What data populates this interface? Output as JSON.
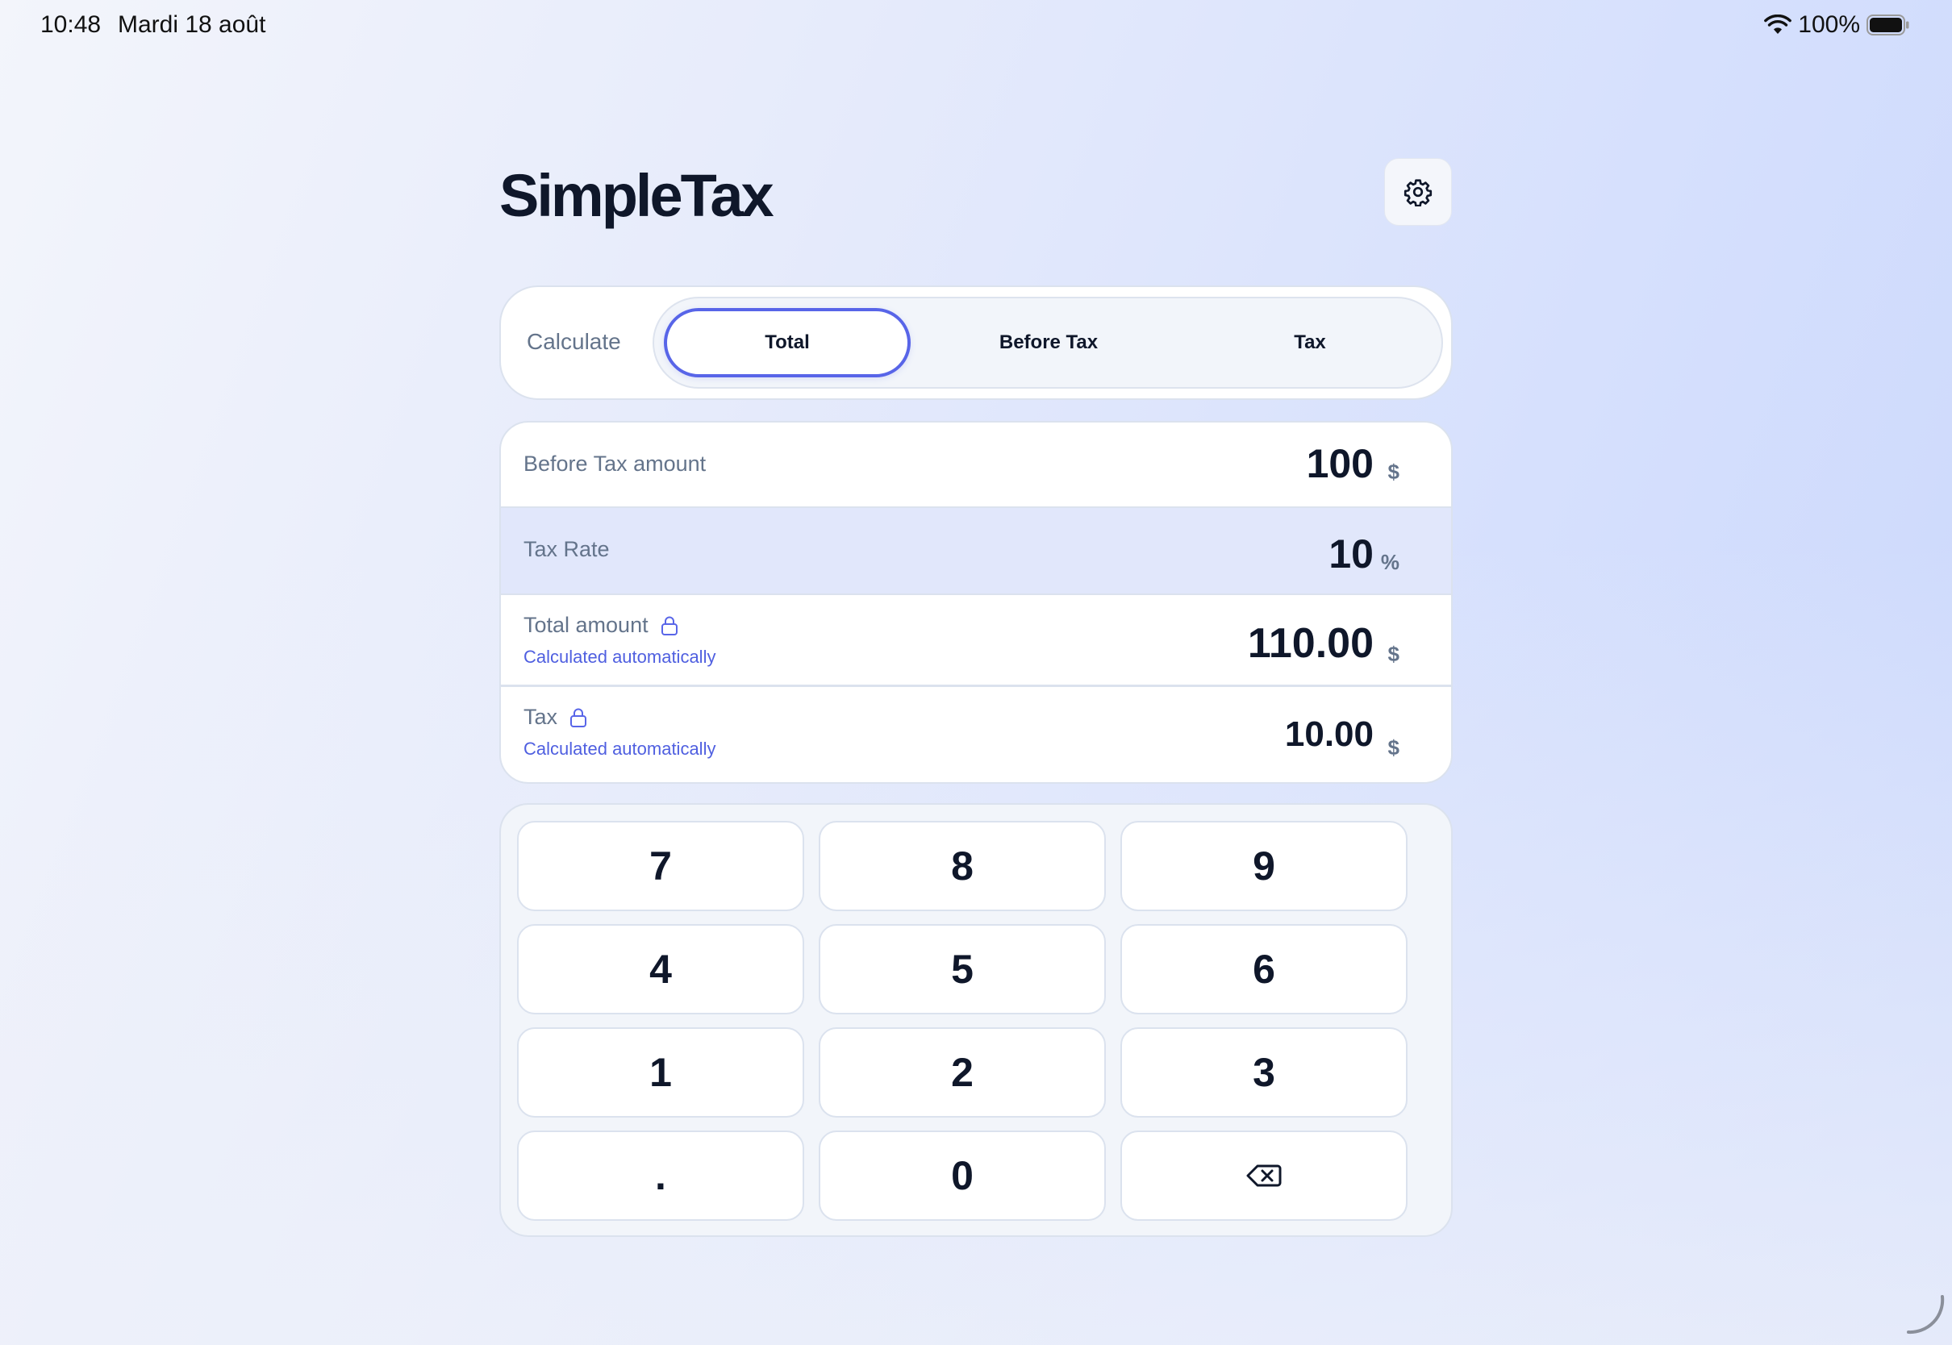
{
  "status_bar": {
    "time": "10:48",
    "date": "Mardi 18 août",
    "battery": "100%"
  },
  "app": {
    "title": "SimpleTax",
    "settings_icon": "gear-icon"
  },
  "mode": {
    "label": "Calculate",
    "options": [
      "Total",
      "Before Tax",
      "Tax"
    ],
    "selected": "Total"
  },
  "fields": {
    "before_tax": {
      "label": "Before Tax amount",
      "value": "100",
      "unit": "$"
    },
    "tax_rate": {
      "label": "Tax Rate",
      "value": "10",
      "unit": "%"
    },
    "total": {
      "label": "Total amount",
      "sub": "Calculated automatically",
      "value": "110.00",
      "unit": "$",
      "icon": "lock-icon"
    },
    "tax": {
      "label": "Tax",
      "sub": "Calculated automatically",
      "value": "10.00",
      "unit": "$",
      "icon": "lock-icon"
    }
  },
  "keypad": {
    "keys": [
      "7",
      "8",
      "9",
      "4",
      "5",
      "6",
      "1",
      "2",
      "3",
      ".",
      "0"
    ],
    "backspace_icon": "backspace-icon"
  },
  "colors": {
    "accent": "#5865e8",
    "text": "#0f172a",
    "muted": "#64748b",
    "selected_row": "#e1e7fb"
  }
}
